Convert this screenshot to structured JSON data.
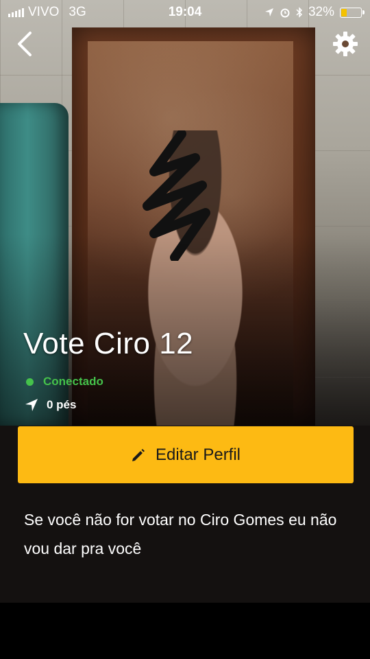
{
  "status_bar": {
    "carrier": "VIVO",
    "network": "3G",
    "time": "19:04",
    "battery": "32%",
    "battery_level": 0.32
  },
  "profile": {
    "name": "Vote Ciro 12",
    "online_status": "Conectado",
    "distance": "0 pés",
    "edit_button_label": "Editar Perfil",
    "bio": "Se você não for votar no Ciro Gomes eu não vou dar pra você"
  },
  "icons": {
    "back": "chevron-left-icon",
    "settings": "gear-icon",
    "location": "location-arrow-icon",
    "edit": "pencil-icon"
  },
  "colors": {
    "accent": "#fdba13",
    "online": "#45c24b"
  }
}
